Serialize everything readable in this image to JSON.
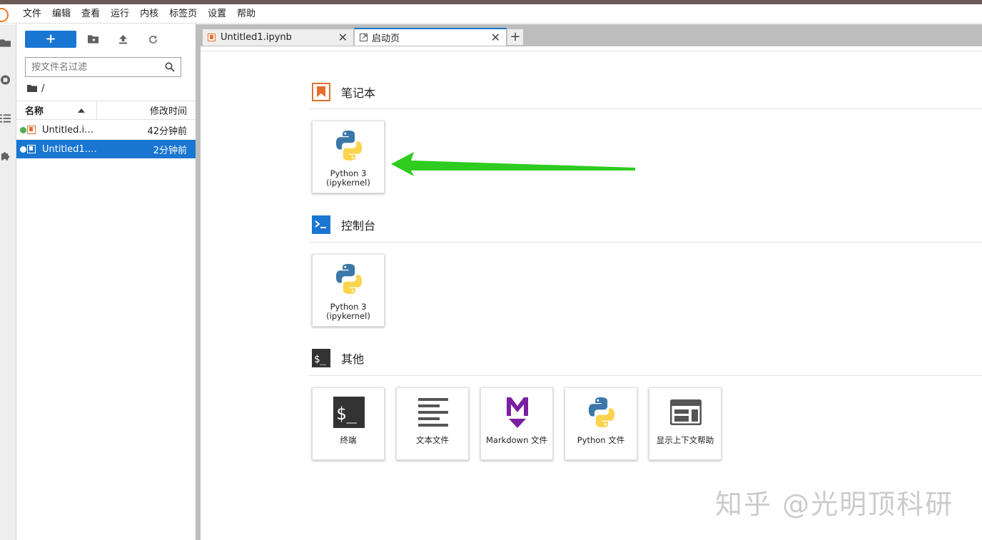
{
  "menubar": {
    "items": [
      "文件",
      "编辑",
      "查看",
      "运行",
      "内核",
      "标签页",
      "设置",
      "帮助"
    ]
  },
  "left_rail": {
    "icons": [
      "folder-icon",
      "running-icon",
      "toc-icon",
      "extension-icon"
    ]
  },
  "filebrowser": {
    "new_label": "+",
    "filter_placeholder": "按文件名过滤",
    "path": "/",
    "col_name": "名称",
    "col_modified": "修改时间",
    "files": [
      {
        "name": "Untitled.ipynb",
        "display": "Untitled.ip…",
        "modified": "42分钟前",
        "running": true,
        "selected": false
      },
      {
        "name": "Untitled1.ipynb",
        "display": "Untitled1.i…",
        "modified": "2分钟前",
        "running": true,
        "selected": true
      }
    ]
  },
  "tabs": [
    {
      "label": "Untitled1.ipynb",
      "active": false
    },
    {
      "label": "启动页",
      "active": true
    }
  ],
  "launcher": {
    "sections": [
      {
        "title": "笔记本",
        "cards": [
          {
            "label_line1": "Python 3",
            "label_line2": "(ipykernel)"
          }
        ]
      },
      {
        "title": "控制台",
        "cards": [
          {
            "label_line1": "Python 3",
            "label_line2": "(ipykernel)"
          }
        ]
      },
      {
        "title": "其他",
        "cards": [
          {
            "label": "终端"
          },
          {
            "label": "文本文件"
          },
          {
            "label": "Markdown 文件"
          },
          {
            "label": "Python 文件"
          },
          {
            "label": "显示上下文帮助"
          }
        ]
      }
    ]
  },
  "watermark": "知乎 @光明顶科研",
  "colors": {
    "accent": "#1976d2",
    "notebook_orange": "#e46e2e",
    "kernel_running": "#4caf50",
    "arrow_green": "#2ecc1f",
    "markdown_purple": "#7b1fa2"
  }
}
